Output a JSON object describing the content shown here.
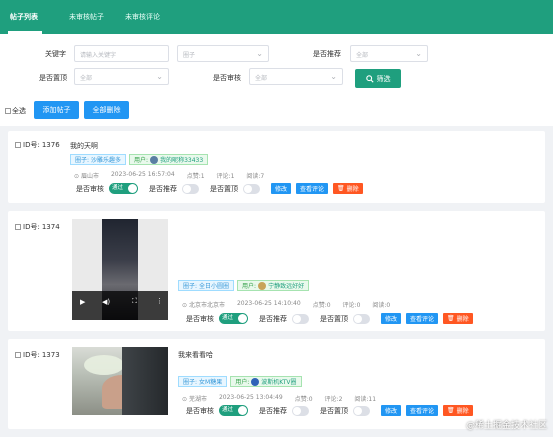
{
  "tabs": [
    {
      "label": "帖子列表"
    },
    {
      "label": "未审核帖子"
    },
    {
      "label": "未审核评论"
    }
  ],
  "filters": {
    "keyword_label": "关键字",
    "keyword_placeholder": "请输入关键字",
    "circle_placeholder": "圈子",
    "recommend_label": "是否推荐",
    "recommend_placeholder": "全部",
    "top_label": "是否置顶",
    "top_placeholder": "全部",
    "audit_label": "是否审核",
    "audit_placeholder": "全部",
    "filter_button": "筛选"
  },
  "toolbar": {
    "select_all": "全选",
    "add_post": "添加帖子",
    "delete_all": "全部删除"
  },
  "labels": {
    "id_prefix": "ID号:",
    "circle_prefix": "圈子:",
    "user_prefix": "用户:",
    "audit": "是否审核",
    "audit_on": "通过",
    "recommend": "是否推荐",
    "top": "是否置顶",
    "edit": "修改",
    "view_comments": "查看评论",
    "delete": "删除"
  },
  "posts": [
    {
      "id": "1376",
      "title": "我的天啊",
      "circle": "沙雕乐趣多",
      "user": "我的昵称33433",
      "location": "眉山市",
      "time": "2023-06-25 16:57:04",
      "likes": "点赞:1",
      "comments": "评论:1",
      "reads": "阅读:7"
    },
    {
      "id": "1374",
      "title": "",
      "circle": "全日小圆圈",
      "user": "宁静致远好好",
      "location": "北京市北京市",
      "time": "2023-06-25 14:10:40",
      "likes": "点赞:0",
      "comments": "评论:0",
      "reads": "阅读:0"
    },
    {
      "id": "1373",
      "title": "我来看看哈",
      "circle": "女M糖果",
      "user": "波斯机KTV圈",
      "location": "芜湖市",
      "time": "2023-06-25 13:04:49",
      "likes": "点赞:0",
      "comments": "评论:2",
      "reads": "阅读:11"
    }
  ],
  "watermark": "@稀土掘金技术社区",
  "colors": {
    "primary": "#1f9f7e",
    "blue": "#2196f3",
    "red": "#ff5722"
  }
}
